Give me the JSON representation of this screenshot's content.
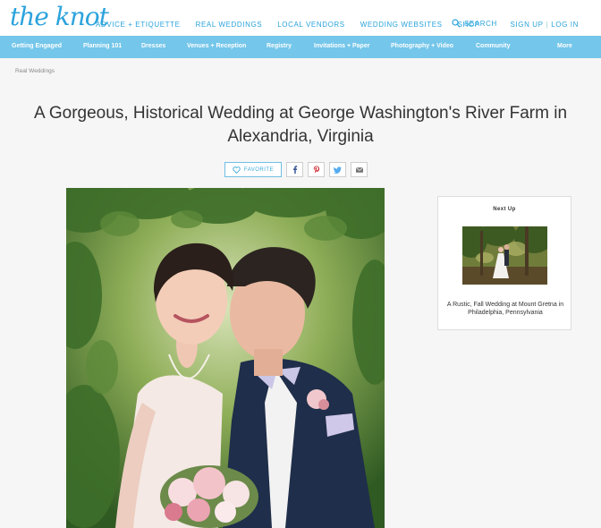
{
  "brand": {
    "logo_text": "the knot",
    "accent": "#2aa3dc",
    "catbar_color": "#74c6ea"
  },
  "top_nav": {
    "items": [
      "ADVICE + ETIQUETTE",
      "REAL WEDDINGS",
      "LOCAL VENDORS",
      "WEDDING WEBSITES",
      "SHOP"
    ],
    "search_label": "SEARCH",
    "sign_up": "SIGN UP",
    "separator": "|",
    "log_in": "LOG IN"
  },
  "category_nav": {
    "items": [
      "Getting Engaged",
      "Planning 101",
      "Dresses",
      "Venues + Reception",
      "Registry",
      "Invitations + Paper",
      "Photography + Video",
      "Community",
      "More"
    ]
  },
  "breadcrumb": "Real Weddings",
  "article": {
    "title_line1": "A Gorgeous, Historical Wedding at George Washington's River Farm in",
    "title_line2": "Alexandria, Virginia",
    "favorite_label": "FAVORITE",
    "share_icons": [
      "facebook-icon",
      "pinterest-icon",
      "twitter-icon",
      "email-icon"
    ]
  },
  "next_up": {
    "label": "Next Up",
    "caption": "A Rustic, Fall Wedding at Mount Gretna in Philadelphia, Pennsylvania"
  }
}
